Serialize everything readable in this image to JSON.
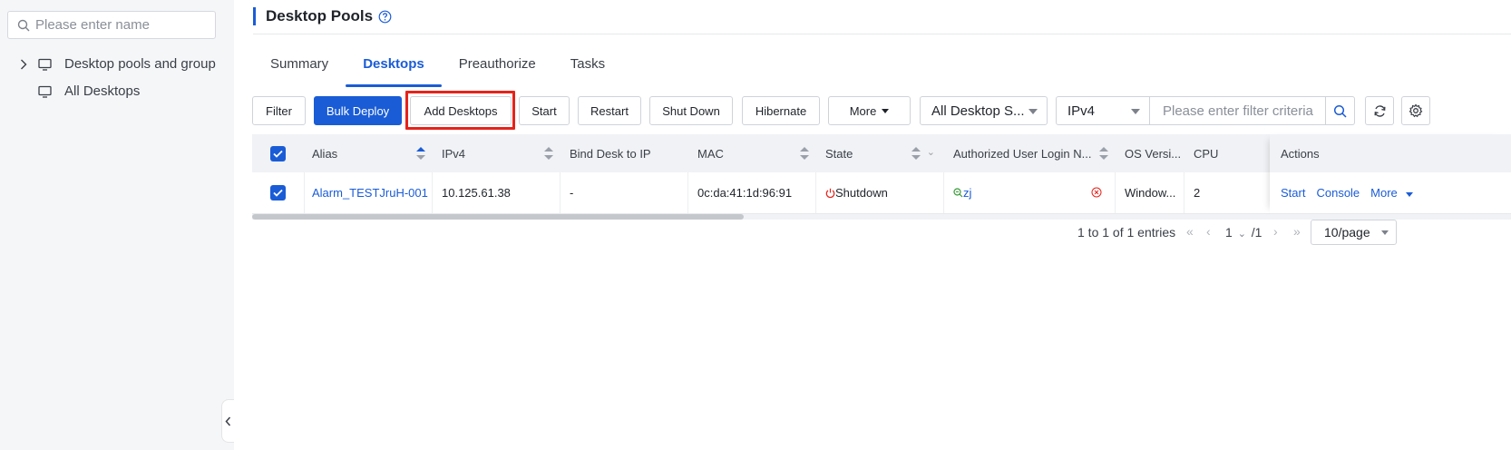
{
  "sidebar": {
    "search_placeholder": "Please enter name",
    "tree": [
      {
        "label": "Desktop pools and group"
      },
      {
        "label": "All Desktops"
      }
    ]
  },
  "header": {
    "title": "Desktop Pools"
  },
  "tabs": [
    {
      "label": "Summary"
    },
    {
      "label": "Desktops",
      "active": true
    },
    {
      "label": "Preauthorize"
    },
    {
      "label": "Tasks"
    }
  ],
  "toolbar": {
    "filter": "Filter",
    "bulk_deploy": "Bulk Deploy",
    "add_desktops": "Add Desktops",
    "start": "Start",
    "restart": "Restart",
    "shut_down": "Shut Down",
    "hibernate": "Hibernate",
    "more": "More",
    "status_select": "All Desktop S...",
    "ip_select": "IPv4",
    "filter_placeholder": "Please enter filter criteria"
  },
  "table": {
    "columns": {
      "alias": "Alias",
      "ipv4": "IPv4",
      "bind": "Bind Desk to IP",
      "mac": "MAC",
      "state": "State",
      "user": "Authorized User Login N...",
      "os": "OS Versi...",
      "cpu": "CPU",
      "actions": "Actions"
    },
    "rows": [
      {
        "alias": "Alarm_TESTJruH-001",
        "ipv4": "10.125.61.38",
        "bind": "-",
        "mac": "0c:da:41:1d:96:91",
        "state": "Shutdown",
        "user": "zj",
        "os": "Window...",
        "cpu": "2",
        "action_start": "Start",
        "action_console": "Console",
        "action_more": "More"
      }
    ]
  },
  "pagination": {
    "info": "1 to 1 of 1 entries",
    "current": "1",
    "total": "/1",
    "page_size": "10/page"
  },
  "colors": {
    "accent": "#1a5cd6",
    "highlight": "#e5231b",
    "state_off": "#e5231b"
  }
}
